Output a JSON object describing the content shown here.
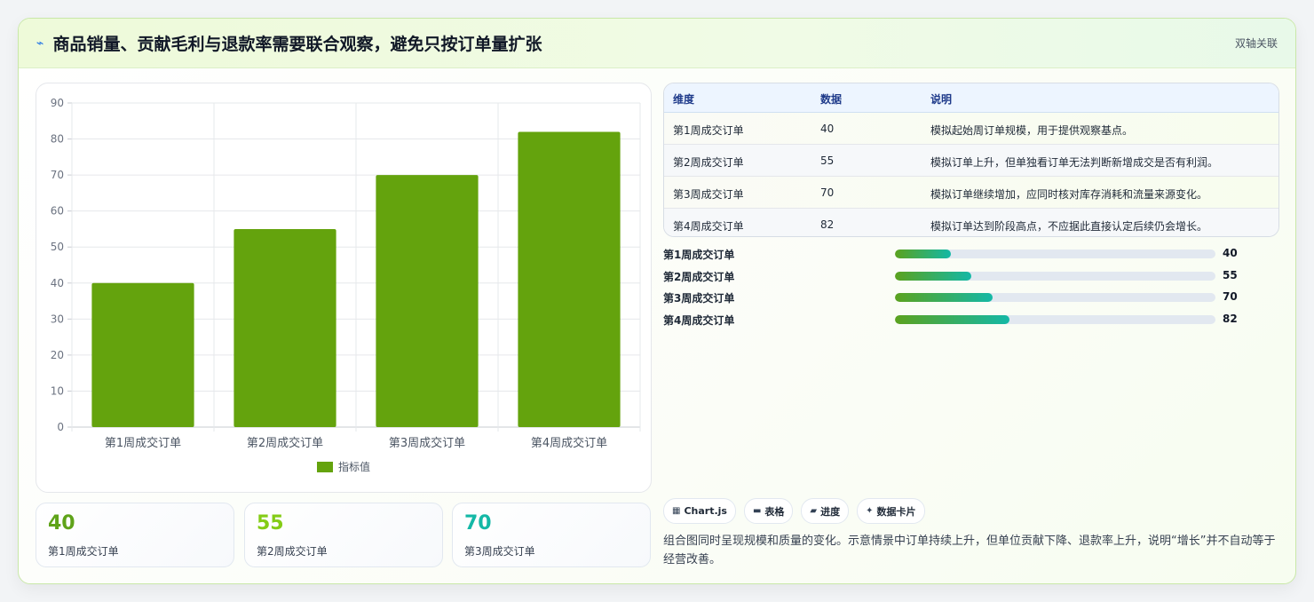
{
  "header": {
    "icon": "trend-icon",
    "title": "商品销量、贡献毛利与退款率需要联合观察，避免只按订单量扩张",
    "tag": "双轴关联"
  },
  "chart_data": {
    "type": "bar",
    "categories": [
      "第1周成交订单",
      "第2周成交订单",
      "第3周成交订单",
      "第4周成交订单"
    ],
    "series": [
      {
        "name": "指标值",
        "values": [
          40,
          55,
          70,
          82
        ],
        "color": "#64a30d"
      }
    ],
    "ylim": [
      0,
      90
    ],
    "yticks": [
      0,
      10,
      20,
      30,
      40,
      50,
      60,
      70,
      80,
      90
    ],
    "grid": true,
    "legend": "bottom"
  },
  "stats": [
    {
      "value": "40",
      "label": "第1周成交订单",
      "color": "#5fa319"
    },
    {
      "value": "55",
      "label": "第2周成交订单",
      "color": "#84cc16"
    },
    {
      "value": "70",
      "label": "第3周成交订单",
      "color": "#14b8a6"
    }
  ],
  "table": {
    "headers": [
      "维度",
      "数据",
      "说明"
    ],
    "rows": [
      [
        "第1周成交订单",
        "40",
        "模拟起始周订单规模，用于提供观察基点。"
      ],
      [
        "第2周成交订单",
        "55",
        "模拟订单上升，但单独看订单无法判断新增成交是否有利润。"
      ],
      [
        "第3周成交订单",
        "70",
        "模拟订单继续增加，应同时核对库存消耗和流量来源变化。"
      ],
      [
        "第4周成交订单",
        "82",
        "模拟订单达到阶段高点，不应据此直接认定后续仍会增长。"
      ]
    ]
  },
  "progress": {
    "max": 230,
    "items": [
      {
        "label": "第1周成交订单",
        "value": 40
      },
      {
        "label": "第2周成交订单",
        "value": 55
      },
      {
        "label": "第3周成交订单",
        "value": 70
      },
      {
        "label": "第4周成交订单",
        "value": 82
      }
    ]
  },
  "chips": [
    {
      "icon": "chart-icon",
      "glyph": "▦",
      "label": "Chart.js"
    },
    {
      "icon": "table-icon",
      "glyph": "▬",
      "label": "表格"
    },
    {
      "icon": "progress-icon",
      "glyph": "▰",
      "label": "进度"
    },
    {
      "icon": "sparkle-icon",
      "glyph": "✦",
      "label": "数据卡片"
    }
  ],
  "description": "组合图同时呈现规模和质量的变化。示意情景中订单持续上升，但单位贡献下降、退款率上升，说明“增长”并不自动等于经营改善。"
}
